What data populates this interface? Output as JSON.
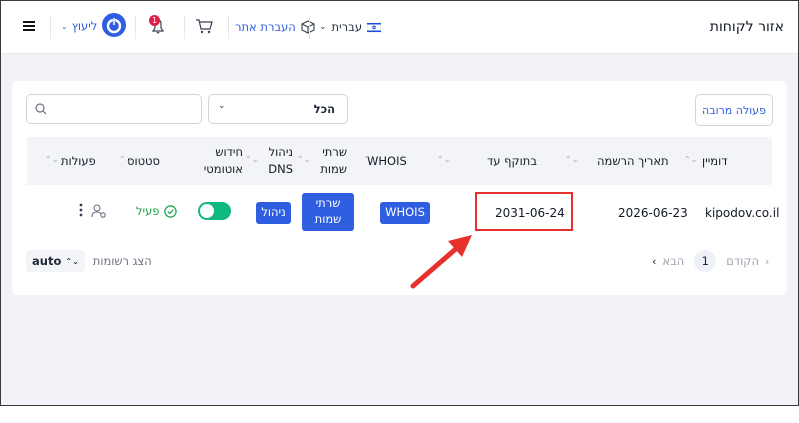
{
  "topbar": {
    "title": "אזור לקוחות",
    "language": "עברית",
    "transfer_site": "העברת אתר",
    "cart_badge": "",
    "notification_count": "1",
    "consult": "ליעוץ"
  },
  "toolbar": {
    "bulk_action": "פעולה מרובה",
    "filter_selected": "הכל",
    "search_placeholder": ""
  },
  "table": {
    "columns": [
      "דומיין",
      "תאריך הרשמה",
      "בתוקף עד",
      "WHOIS",
      "שרתי שמות",
      "ניהול DNS",
      "חידוש אוטומטי",
      "סטטוס",
      "פעולות"
    ],
    "row": {
      "domain": "kipodov.co.il",
      "registered": "2026-06-23",
      "expires": "2031-06-24",
      "whois_btn": "WHOIS",
      "ns_btn": "שרתי שמות",
      "dns_btn": "ניהול",
      "auto_renew": true,
      "status": "פעיל"
    }
  },
  "pagination": {
    "prev": "הקודם",
    "page": "1",
    "next": "הבא",
    "show_records": "הצג רשומות",
    "per_page": "auto"
  },
  "colors": {
    "accent": "#2f5fe0",
    "status_green": "#16a34a",
    "annotation_red": "#e8302d"
  }
}
